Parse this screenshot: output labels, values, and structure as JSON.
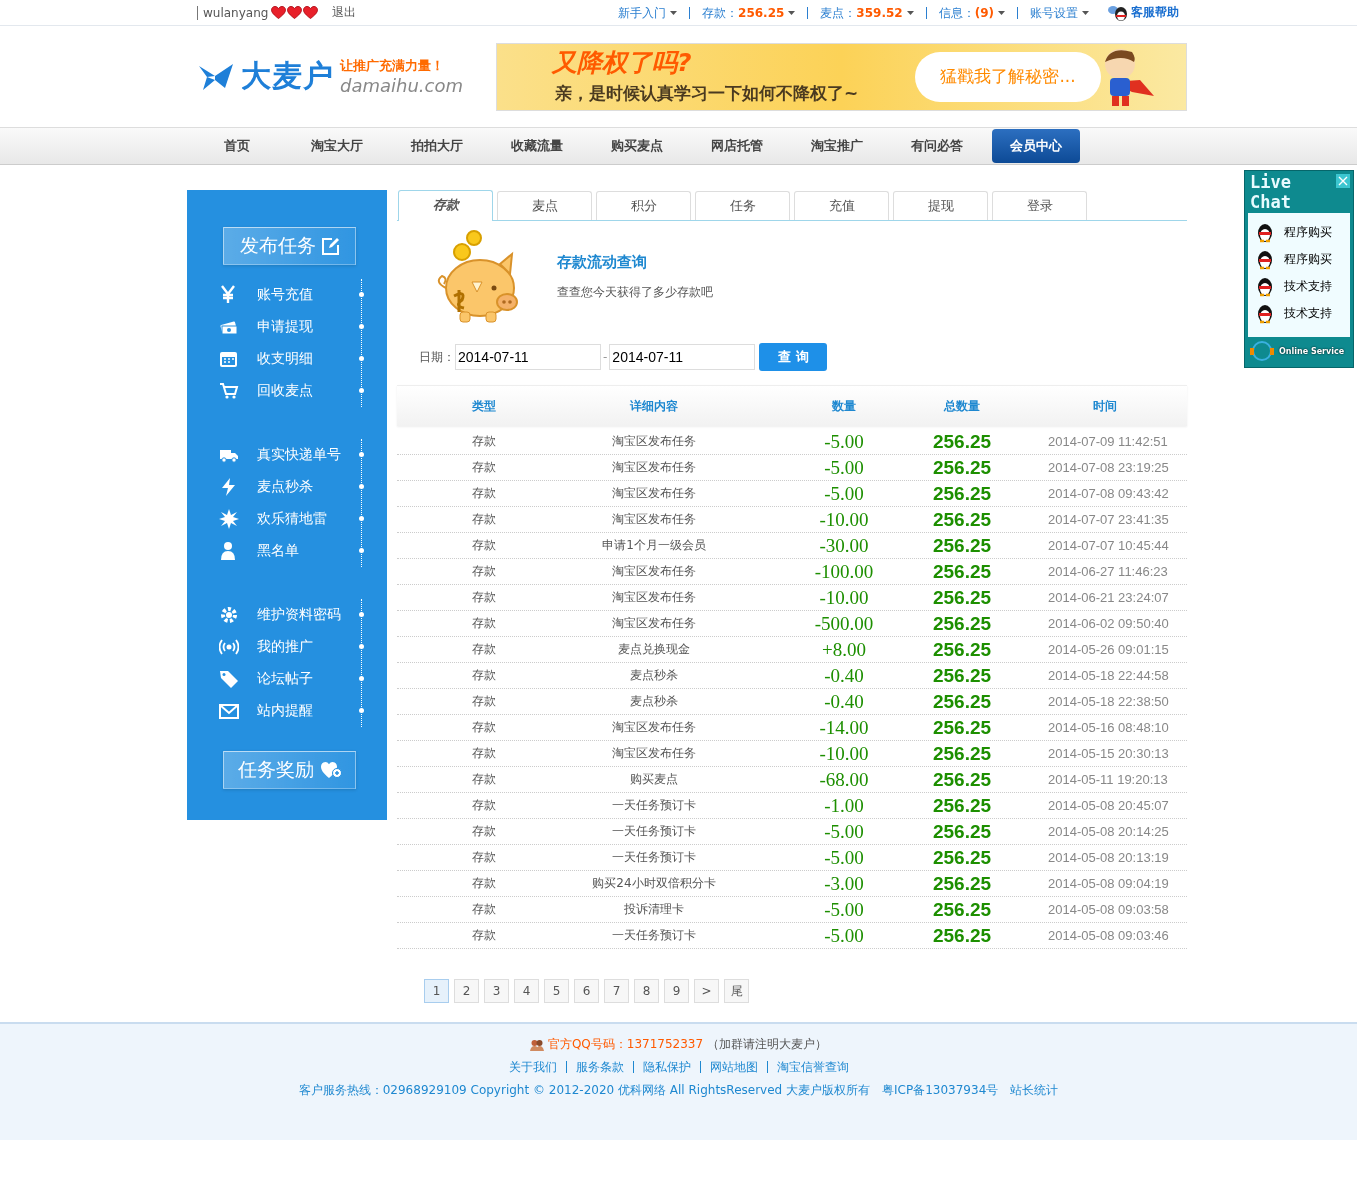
{
  "top_bar": {
    "user": "wulanyang",
    "logout": "退出",
    "links": [
      {
        "label": "新手入门",
        "dropdown": true
      },
      {
        "label": "存款：",
        "value": "256.25",
        "dropdown": true
      },
      {
        "label": "麦点：",
        "value": "359.52",
        "dropdown": true
      },
      {
        "label": "信息：",
        "value": "(9)",
        "dropdown": true
      },
      {
        "label": "账号设置",
        "dropdown": true
      }
    ],
    "help": "客服帮助"
  },
  "header": {
    "logo": "大麦户",
    "slogan": "让推广充满力量！",
    "domain": "damaihu.com",
    "banner": {
      "title": "又降权了吗?",
      "subtitle": "亲，是时候认真学习一下如何不降权了~",
      "bubble": "猛戳我了解秘密..."
    }
  },
  "nav": [
    {
      "label": "首页",
      "selected": false
    },
    {
      "label": "淘宝大厅",
      "selected": false
    },
    {
      "label": "拍拍大厅",
      "selected": false
    },
    {
      "label": "收藏流量",
      "selected": false
    },
    {
      "label": "购买麦点",
      "selected": false
    },
    {
      "label": "网店托管",
      "selected": false
    },
    {
      "label": "淘宝推广",
      "selected": false
    },
    {
      "label": "有问必答",
      "selected": false
    },
    {
      "label": "会员中心",
      "selected": true
    }
  ],
  "sidebar": {
    "publish": "发布任务",
    "groups": [
      [
        "账号充值",
        "申请提现",
        "收支明细",
        "回收麦点"
      ],
      [
        "真实快递单号",
        "麦点秒杀",
        "欢乐猜地雷",
        "黑名单"
      ],
      [
        "维护资料密码",
        "我的推广",
        "论坛帖子",
        "站内提醒"
      ]
    ],
    "reward": "任务奖励"
  },
  "tabs": [
    {
      "label": "存款",
      "selected": true
    },
    {
      "label": "麦点",
      "selected": false
    },
    {
      "label": "积分",
      "selected": false
    },
    {
      "label": "任务",
      "selected": false
    },
    {
      "label": "充值",
      "selected": false
    },
    {
      "label": "提现",
      "selected": false
    },
    {
      "label": "登录",
      "selected": false
    }
  ],
  "query": {
    "title": "存款流动查询",
    "description": "查查您今天获得了多少存款吧",
    "date_label": "日期：",
    "date_from": "2014-07-11",
    "separator": "-",
    "date_to": "2014-07-11",
    "button": "查 询"
  },
  "table": {
    "columns": [
      "类型",
      "详细内容",
      "数量",
      "总数量",
      "时间"
    ],
    "rows": [
      [
        "存款",
        "淘宝区发布任务",
        "-5.00",
        "256.25",
        "2014-07-09 11:42:51"
      ],
      [
        "存款",
        "淘宝区发布任务",
        "-5.00",
        "256.25",
        "2014-07-08 23:19:25"
      ],
      [
        "存款",
        "淘宝区发布任务",
        "-5.00",
        "256.25",
        "2014-07-08 09:43:42"
      ],
      [
        "存款",
        "淘宝区发布任务",
        "-10.00",
        "256.25",
        "2014-07-07 23:41:35"
      ],
      [
        "存款",
        "申请1个月一级会员",
        "-30.00",
        "256.25",
        "2014-07-07 10:45:44"
      ],
      [
        "存款",
        "淘宝区发布任务",
        "-100.00",
        "256.25",
        "2014-06-27 11:46:23"
      ],
      [
        "存款",
        "淘宝区发布任务",
        "-10.00",
        "256.25",
        "2014-06-21 23:24:07"
      ],
      [
        "存款",
        "淘宝区发布任务",
        "-500.00",
        "256.25",
        "2014-06-02 09:50:40"
      ],
      [
        "存款",
        "麦点兑换现金",
        "+8.00",
        "256.25",
        "2014-05-26 09:01:15"
      ],
      [
        "存款",
        "麦点秒杀",
        "-0.40",
        "256.25",
        "2014-05-18 22:44:58"
      ],
      [
        "存款",
        "麦点秒杀",
        "-0.40",
        "256.25",
        "2014-05-18 22:38:50"
      ],
      [
        "存款",
        "淘宝区发布任务",
        "-14.00",
        "256.25",
        "2014-05-16 08:48:10"
      ],
      [
        "存款",
        "淘宝区发布任务",
        "-10.00",
        "256.25",
        "2014-05-15 20:30:13"
      ],
      [
        "存款",
        "购买麦点",
        "-68.00",
        "256.25",
        "2014-05-11 19:20:13"
      ],
      [
        "存款",
        "一天任务预订卡",
        "-1.00",
        "256.25",
        "2014-05-08 20:45:07"
      ],
      [
        "存款",
        "一天任务预订卡",
        "-5.00",
        "256.25",
        "2014-05-08 20:14:25"
      ],
      [
        "存款",
        "一天任务预订卡",
        "-5.00",
        "256.25",
        "2014-05-08 20:13:19"
      ],
      [
        "存款",
        "购买24小时双倍积分卡",
        "-3.00",
        "256.25",
        "2014-05-08 09:04:19"
      ],
      [
        "存款",
        "投诉清理卡",
        "-5.00",
        "256.25",
        "2014-05-08 09:03:58"
      ],
      [
        "存款",
        "一天任务预订卡",
        "-5.00",
        "256.25",
        "2014-05-08 09:03:46"
      ]
    ]
  },
  "pagination": [
    {
      "label": "1",
      "selected": true
    },
    {
      "label": "2",
      "selected": false
    },
    {
      "label": "3",
      "selected": false
    },
    {
      "label": "4",
      "selected": false
    },
    {
      "label": "5",
      "selected": false
    },
    {
      "label": "6",
      "selected": false
    },
    {
      "label": "7",
      "selected": false
    },
    {
      "label": "8",
      "selected": false
    },
    {
      "label": "9",
      "selected": false
    },
    {
      "label": ">",
      "selected": false
    },
    {
      "label": "尾",
      "selected": false
    }
  ],
  "live_chat": {
    "title": "Live Chat",
    "items": [
      "程序购买",
      "程序购买",
      "技术支持",
      "技术支持"
    ],
    "footer": "Online Service"
  },
  "footer": {
    "qq": "官方QQ号码：1371752337",
    "qq_note": "（加群请注明大麦户）",
    "links": [
      "关于我们",
      "服务条款",
      "隐私保护",
      "网站地图",
      "淘宝信誉查询"
    ],
    "copyright": "客户服务热线：02968929109 Copyright © 2012-2020 优科网络 All RightsReserved 大麦户版权所有",
    "icp": "粤ICP备13037934号",
    "stats": "站长统计"
  }
}
